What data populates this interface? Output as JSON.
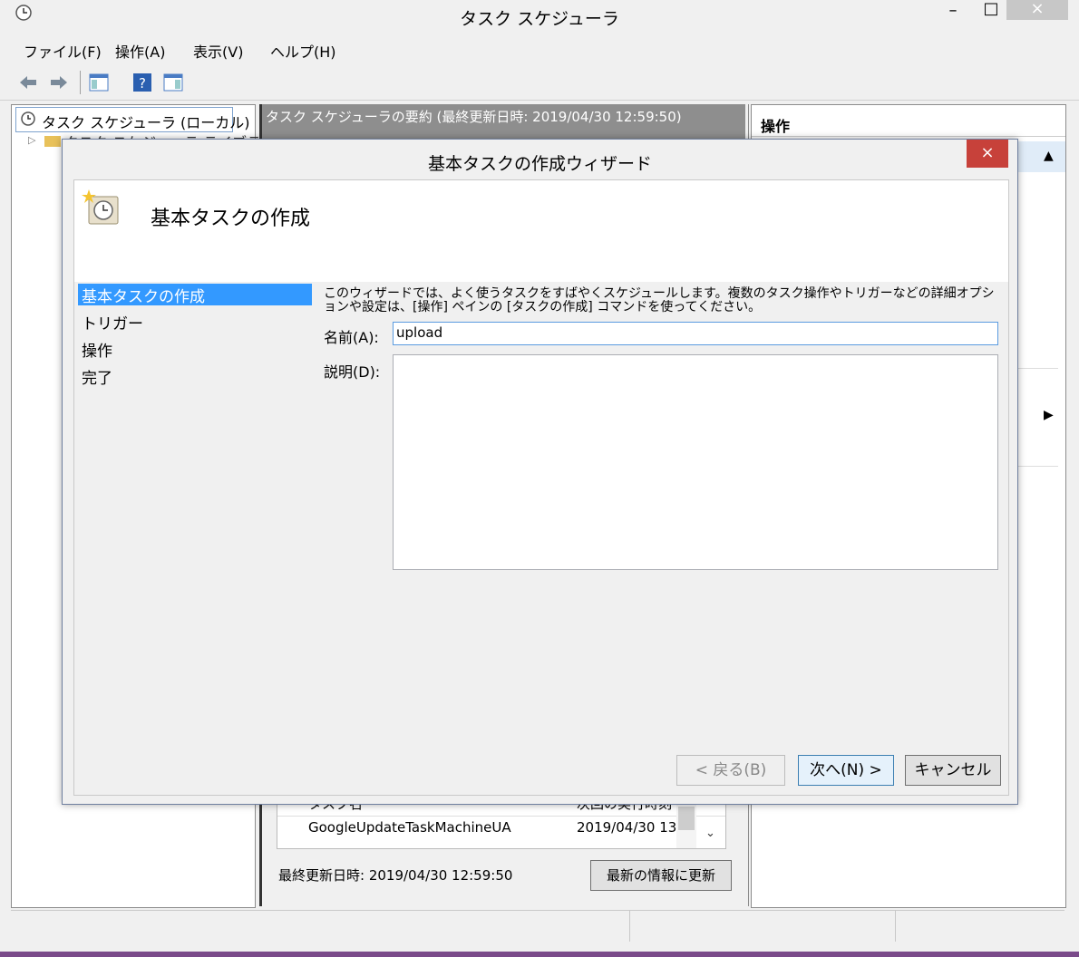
{
  "window": {
    "title": "タスク スケジューラ",
    "minimize": "–",
    "maximize": "□",
    "close": "×"
  },
  "menu": [
    "ファイル(F)",
    "操作(A)",
    "表示(V)",
    "ヘルプ(H)"
  ],
  "tree": {
    "root": "タスク スケジューラ (ローカル)",
    "child_partial": "タスク スケジューラ ライブラリ"
  },
  "center": {
    "header": "タスク スケジューラの要約 (最終更新日時: 2019/04/30 12:59:50)",
    "table": {
      "columns": [
        "タスク名",
        "次回の実行時刻"
      ],
      "rows": [
        [
          "GoogleUpdateTaskMachineUA",
          "2019/04/30 13"
        ]
      ]
    },
    "last_updated": "最終更新日時: 2019/04/30 12:59:50",
    "refresh_button": "最新の情報に更新"
  },
  "right": {
    "header": "操作"
  },
  "dialog": {
    "title": "基本タスクの作成ウィザード",
    "close": "×",
    "heading": "基本タスクの作成",
    "steps": [
      "基本タスクの作成",
      "トリガー",
      "操作",
      "完了"
    ],
    "description_line1": "このウィザードでは、よく使うタスクをすばやくスケジュールします。複数のタスク操作やトリガーなどの詳細オプシ",
    "description_line2": "ョンや設定は、[操作] ペインの [タスクの作成] コマンドを使ってください。",
    "name_label": "名前(A):",
    "name_value": "upload",
    "desc_label": "説明(D):",
    "desc_value": "",
    "back_button": "< 戻る(B)",
    "next_button": "次へ(N) >",
    "cancel_button": "キャンセル"
  }
}
